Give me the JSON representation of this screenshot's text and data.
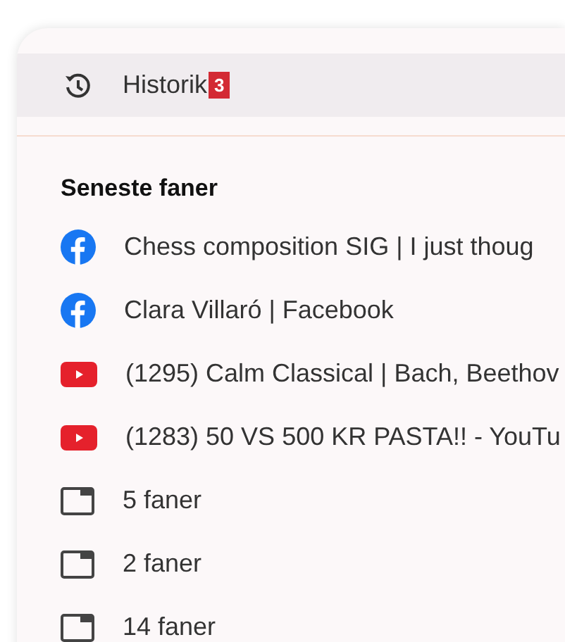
{
  "header": {
    "title": "Historik",
    "badge": "3"
  },
  "section": {
    "heading": "Seneste faner"
  },
  "items": [
    {
      "kind": "facebook",
      "label": "Chess composition SIG | I just thoug"
    },
    {
      "kind": "facebook",
      "label": "Clara Villaró | Facebook"
    },
    {
      "kind": "youtube",
      "label": "(1295) Calm Classical | Bach, Beethov"
    },
    {
      "kind": "youtube",
      "label": "(1283) 50 VS 500 KR PASTA!! - YouTu"
    },
    {
      "kind": "window",
      "label": "5 faner"
    },
    {
      "kind": "window",
      "label": "2 faner"
    },
    {
      "kind": "window",
      "label": "14 faner"
    }
  ]
}
